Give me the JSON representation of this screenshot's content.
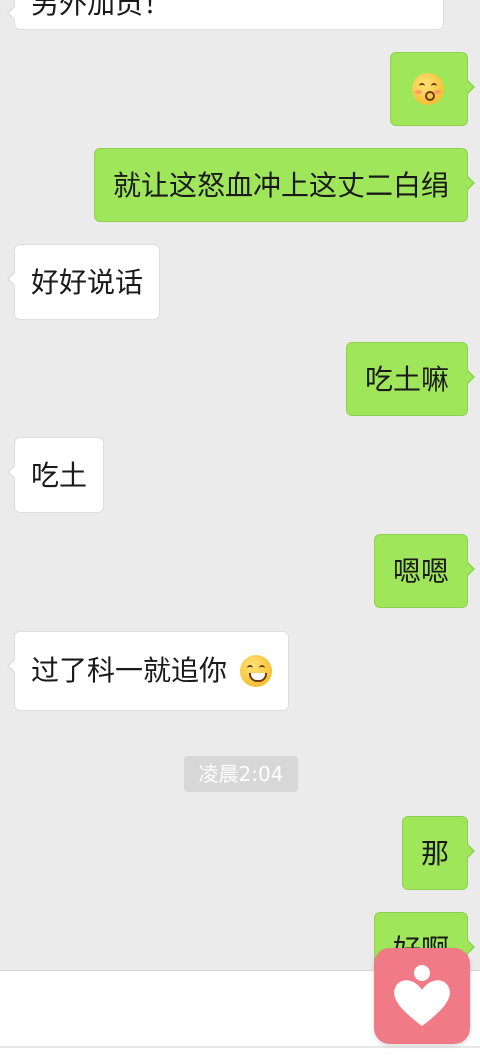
{
  "messages": [
    {
      "id": "m0",
      "side": "in",
      "text": "另外加员！",
      "emoji": null
    },
    {
      "id": "m1",
      "side": "out",
      "text": "",
      "emoji": "kissing-face"
    },
    {
      "id": "m2",
      "side": "out",
      "text": "就让这怒血冲上这丈二白绢",
      "emoji": null
    },
    {
      "id": "m3",
      "side": "in",
      "text": "好好说话",
      "emoji": null
    },
    {
      "id": "m4",
      "side": "out",
      "text": "吃土嘛",
      "emoji": null
    },
    {
      "id": "m5",
      "side": "in",
      "text": "吃土",
      "emoji": null
    },
    {
      "id": "m6",
      "side": "out",
      "text": "嗯嗯",
      "emoji": null
    },
    {
      "id": "m7",
      "side": "in",
      "text": "过了科一就追你",
      "emoji": "grinning-face"
    },
    {
      "id": "m8",
      "side": "out",
      "text": "那",
      "emoji": null
    },
    {
      "id": "m9",
      "side": "out",
      "text": "好啊",
      "emoji": null
    }
  ],
  "timestamp": "凌晨2:04",
  "fab": {
    "icon": "heart-person-icon",
    "color": "#f07b86"
  },
  "colors": {
    "background": "#ebebeb",
    "outgoing": "#9fe65a",
    "incoming": "#ffffff"
  }
}
